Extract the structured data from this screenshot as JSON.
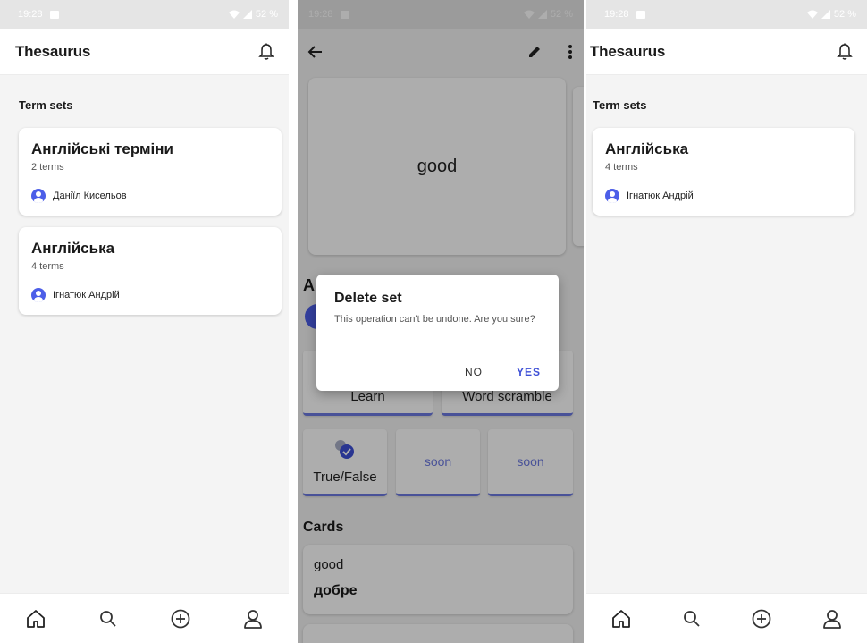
{
  "status": {
    "time": "19:28",
    "battery": "52 %"
  },
  "home_left": {
    "app_title": "Thesaurus",
    "section_title": "Term sets",
    "sets": [
      {
        "title": "Англійські терміни",
        "count": "2 terms",
        "author": "Даніїл Кисельов"
      },
      {
        "title": "Англійська",
        "count": "4 terms",
        "author": "Ігнатюк Андрій"
      }
    ]
  },
  "detail": {
    "card_front": "good",
    "set_title_peek": "Ar",
    "modes": {
      "learn": "Learn",
      "scramble": "Word scramble",
      "truefalse": "True/False",
      "soon1": "soon",
      "soon2": "soon"
    },
    "cards_title": "Cards",
    "term": {
      "word": "good",
      "definition": "добре"
    },
    "dialog": {
      "title": "Delete set",
      "body": "This operation can't be undone. Are you sure?",
      "no": "NO",
      "yes": "YES"
    }
  },
  "home_right": {
    "app_title": "Thesaurus",
    "section_title": "Term sets",
    "sets": [
      {
        "title": "Англійська",
        "count": "4 terms",
        "author": "Ігнатюк Андрій"
      }
    ]
  },
  "colors": {
    "accent": "#4c5ee8",
    "accent_text": "#3d4fd6"
  },
  "icons": {
    "bell": "bell-icon",
    "home": "home-icon",
    "search": "search-icon",
    "add": "add-circle-icon",
    "profile": "profile-icon"
  }
}
